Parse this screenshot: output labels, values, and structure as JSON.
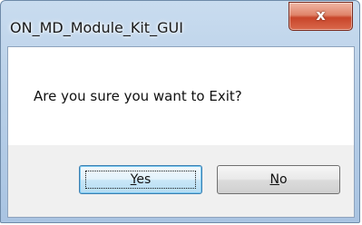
{
  "window": {
    "title": "ON_MD_Module_Kit_GUI",
    "close_icon": "close-icon",
    "close_glyph": "x"
  },
  "dialog": {
    "message": "Are you sure you want to Exit?"
  },
  "buttons": {
    "yes": {
      "accel": "Y",
      "rest": "es"
    },
    "no": {
      "accel": "N",
      "rest": "o"
    }
  },
  "colors": {
    "titlebar": "#b9d0e8",
    "close_button": "#c8452a",
    "default_button_border": "#3c7fb1"
  }
}
